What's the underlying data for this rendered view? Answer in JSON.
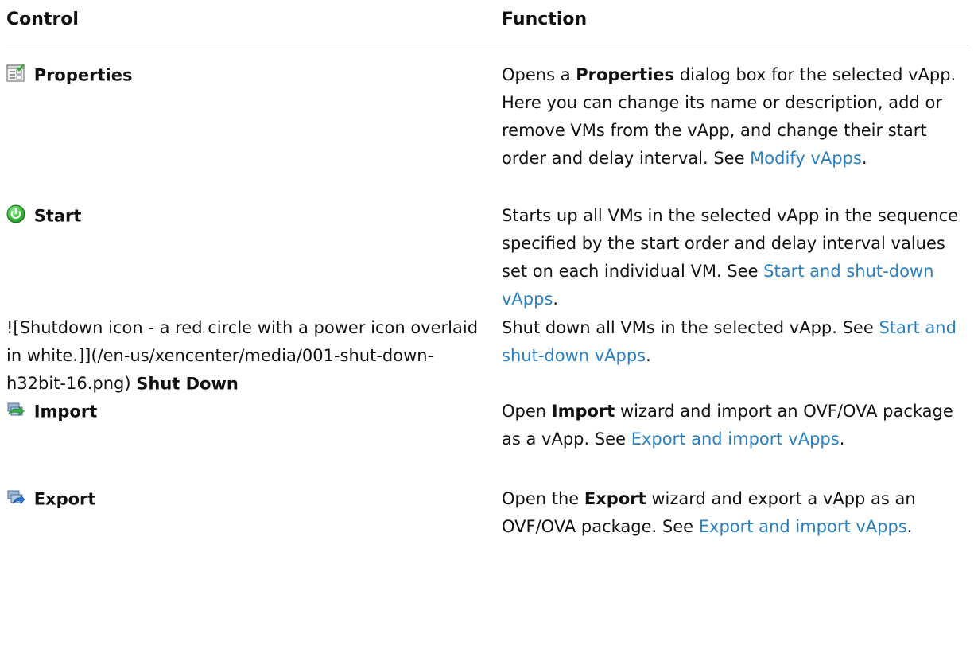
{
  "header": {
    "control": "Control",
    "function": "Function"
  },
  "rows": [
    {
      "control": {
        "icon": "properties-icon",
        "label": "Properties"
      },
      "function": [
        {
          "t": "Opens a ",
          "s": "plain"
        },
        {
          "t": "Properties",
          "s": "bold"
        },
        {
          "t": " dialog box for the selected vApp. Here you can change its name or description, add or remove VMs from the vApp, and change their start order and delay interval. See ",
          "s": "plain"
        },
        {
          "t": "Modify vApps",
          "s": "link"
        },
        {
          "t": ".",
          "s": "plain"
        }
      ]
    },
    {
      "control": {
        "icon": "start-power-icon",
        "label": "Start"
      },
      "function": [
        {
          "t": "Starts up all VMs in the selected vApp in the sequence specified by the start order and delay interval values set on each individual VM. See ",
          "s": "plain"
        },
        {
          "t": "Start and shut-down vApps",
          "s": "link"
        },
        {
          "t": ".",
          "s": "plain"
        }
      ]
    },
    {
      "control": {
        "raw": "![Shutdown icon - a red circle with a power icon overlaid in white.]](/en-us/xencenter/media/001-shut-down-h32bit-16.png) ",
        "label": "Shut Down"
      },
      "function": [
        {
          "t": "Shut down all VMs in the selected vApp. See ",
          "s": "plain"
        },
        {
          "t": "Start and shut-down vApps",
          "s": "link"
        },
        {
          "t": ".",
          "s": "plain"
        }
      ]
    },
    {
      "control": {
        "icon": "import-icon",
        "label": "Import"
      },
      "function": [
        {
          "t": "Open ",
          "s": "plain"
        },
        {
          "t": "Import",
          "s": "bold"
        },
        {
          "t": " wizard and import an OVF/OVA package as a vApp. See ",
          "s": "plain"
        },
        {
          "t": "Export and import vApps",
          "s": "link"
        },
        {
          "t": ".",
          "s": "plain"
        }
      ]
    },
    {
      "control": {
        "icon": "export-icon",
        "label": "Export"
      },
      "function": [
        {
          "t": "Open the ",
          "s": "plain"
        },
        {
          "t": "Export",
          "s": "bold"
        },
        {
          "t": " wizard and export a vApp as an OVF/OVA package. See ",
          "s": "plain"
        },
        {
          "t": "Export and import vApps",
          "s": "link"
        },
        {
          "t": ".",
          "s": "plain"
        }
      ]
    }
  ]
}
